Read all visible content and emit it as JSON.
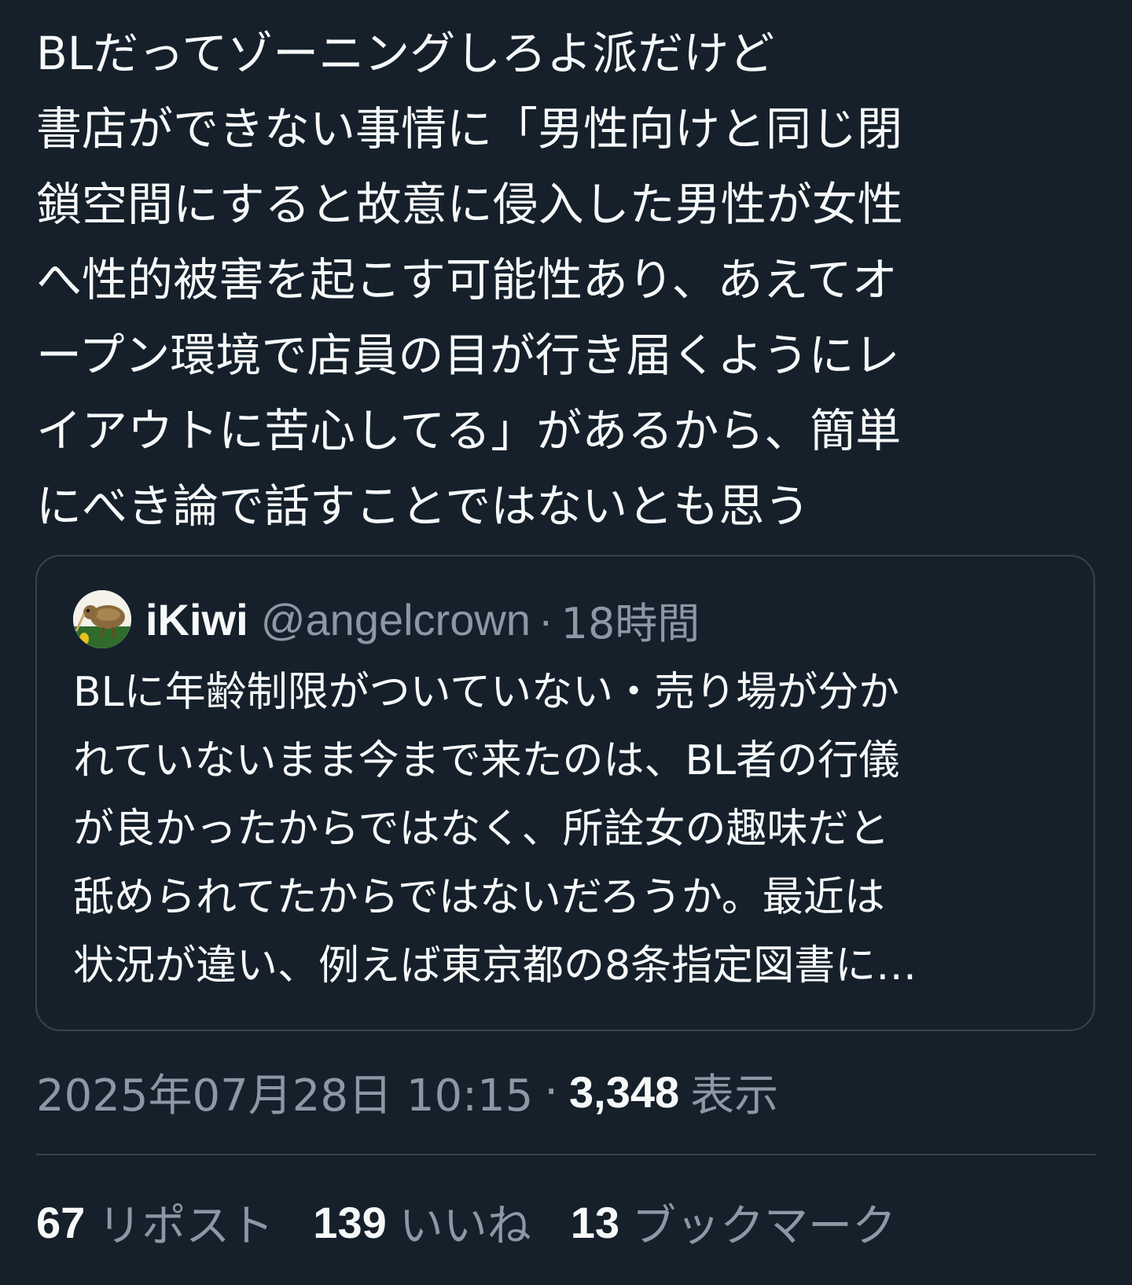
{
  "post": {
    "text": "BLだってゾーニングしろよ派だけど\n書店ができない事情に「男性向けと同じ閉\n鎖空間にすると故意に侵入した男性が女性\nへ性的被害を起こす可能性あり、あえてオ\nープン環境で店員の目が行き届くようにレ\nイアウトに苦心してる」があるから、簡単\nにべき論で話すことではないとも思う"
  },
  "quote": {
    "display_name": "iKiwi",
    "handle": "@angelcrown",
    "separator": "·",
    "time_ago": "18時間",
    "avatar_icon": "kiwi-bird-avatar",
    "text": "BLに年齢制限がついていない・売り場が分か\nれていないまま今まで来たのは、BL者の行儀\nが良かったからではなく、所詮女の趣味だと\n舐められてたからではないだろうか。最近は\n状況が違い、例えば東京都の8条指定図書に…"
  },
  "meta": {
    "date": "2025年07月28日 10:15",
    "separator": "·",
    "views_count": "3,348",
    "views_label": "表示"
  },
  "stats": {
    "reposts_count": "67",
    "reposts_label": "リポスト",
    "likes_count": "139",
    "likes_label": "いいね",
    "bookmarks_count": "13",
    "bookmarks_label": "ブックマーク"
  },
  "colors": {
    "background": "#15202b",
    "text": "#f7f9f9",
    "secondary": "#8b98a5",
    "border": "#38444d"
  }
}
